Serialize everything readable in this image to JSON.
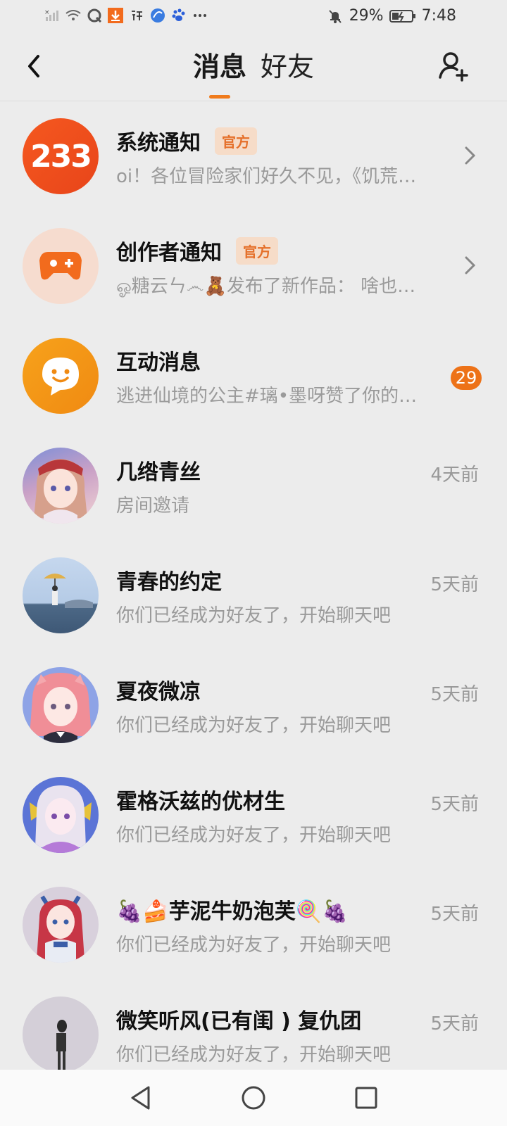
{
  "status_bar": {
    "battery": "29%",
    "time": "7:48"
  },
  "header": {
    "tabs": [
      {
        "label": "消息",
        "active": true
      },
      {
        "label": "好友",
        "active": false
      }
    ]
  },
  "accent": "#f07b1c",
  "conversations": [
    {
      "name": "系统通知",
      "official_label": "官方",
      "preview": "oi！各位冒险家们好久不见，《饥荒…",
      "avatar": "orange-233-icon",
      "avatar_text": "233"
    },
    {
      "name": "创作者通知",
      "official_label": "官方",
      "preview": "ஓ糖云ㄣ෴🧸发布了新作品：  啥也…",
      "avatar": "gamepad-icon"
    },
    {
      "name": "互动消息",
      "preview": "逃进仙境的公主#璃•墨呀赞了你的…",
      "avatar": "smile-bubble-icon",
      "badge": "29"
    },
    {
      "name": "几绺青丝",
      "preview": "房间邀请",
      "time": "4天前",
      "avatar": "anime-avatar"
    },
    {
      "name": "青春的约定",
      "preview": "你们已经成为好友了，开始聊天吧",
      "time": "5天前",
      "avatar": "umbrella-scene-avatar"
    },
    {
      "name": "夏夜微凉",
      "preview": "你们已经成为好友了，开始聊天吧",
      "time": "5天前",
      "avatar": "pink-hair-avatar"
    },
    {
      "name": "霍格沃兹的优材生",
      "preview": "你们已经成为好友了，开始聊天吧",
      "time": "5天前",
      "avatar": "white-hair-avatar"
    },
    {
      "name": "🍇🍰芋泥牛奶泡芙🍭🍇",
      "preview": "你们已经成为好友了，开始聊天吧",
      "time": "5天前",
      "avatar": "red-hair-avatar"
    },
    {
      "name": "微笑听风(已有闺 ) 复仇团",
      "preview": "你们已经成为好友了，开始聊天吧",
      "time": "5天前",
      "avatar": "figure-avatar"
    }
  ]
}
